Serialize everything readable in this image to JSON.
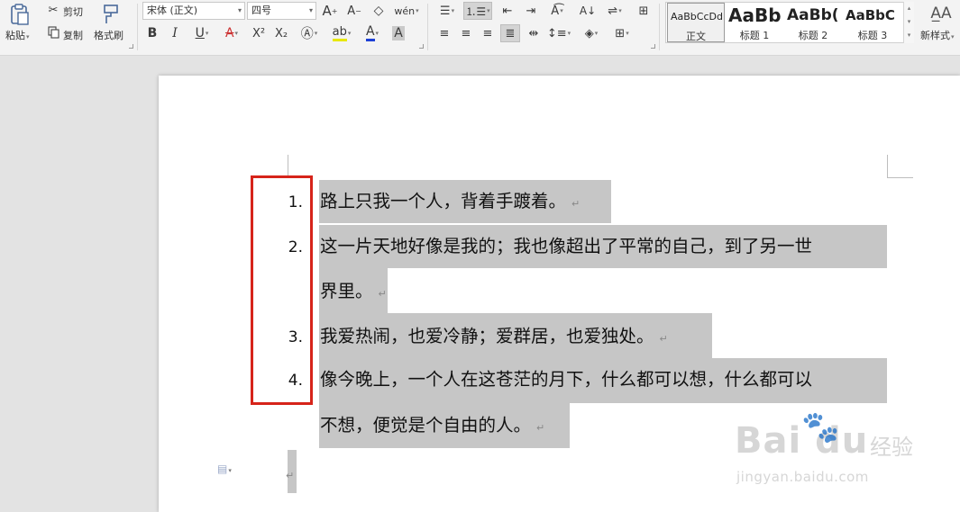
{
  "toolbar": {
    "clipboard": {
      "paste_label": "粘贴",
      "cut_label": "剪切",
      "copy_label": "复制",
      "format_painter_label": "格式刷"
    },
    "font": {
      "font_name": "宋体 (正文)",
      "font_size": "四号",
      "bold": "B",
      "italic": "I",
      "underline": "U",
      "strike": "A",
      "superscript": "X²",
      "subscript": "X₂",
      "font_color_letter": "A",
      "highlight_letter": "A"
    },
    "paragraph": {
      "numbering_active": true
    },
    "styles": {
      "items": [
        {
          "preview": "AaBbCcDd",
          "name": "正文"
        },
        {
          "preview": "AaBb",
          "name": "标题 1"
        },
        {
          "preview": "AaBb(",
          "name": "标题 2"
        },
        {
          "preview": "AaBbC",
          "name": "标题 3"
        }
      ],
      "new_style_label": "新样式"
    }
  },
  "document": {
    "list": [
      {
        "number": "1.",
        "lines": [
          "路上只我一个人，背着手踱着。"
        ]
      },
      {
        "number": "2.",
        "lines": [
          "这一片天地好像是我的；我也像超出了平常的自己，到了另一世",
          "界里。"
        ]
      },
      {
        "number": "3.",
        "lines": [
          "我爱热闹，也爱冷静；爱群居，也爱独处。"
        ]
      },
      {
        "number": "4.",
        "lines": [
          "像今晚上，一个人在这苍茫的月下，什么都可以想，什么都可以",
          "不想，便觉是个自由的人。"
        ]
      }
    ],
    "paragraph_mark": "↵"
  },
  "annotation": {
    "color": "#d6241a"
  },
  "watermark": {
    "logo": "Bai du",
    "cn": "经验",
    "url": "jingyan.baidu.com"
  },
  "colors": {
    "selection": "#c6c6c6",
    "ribbon": "#f3f3f3",
    "workspace": "#e3e3e3"
  }
}
